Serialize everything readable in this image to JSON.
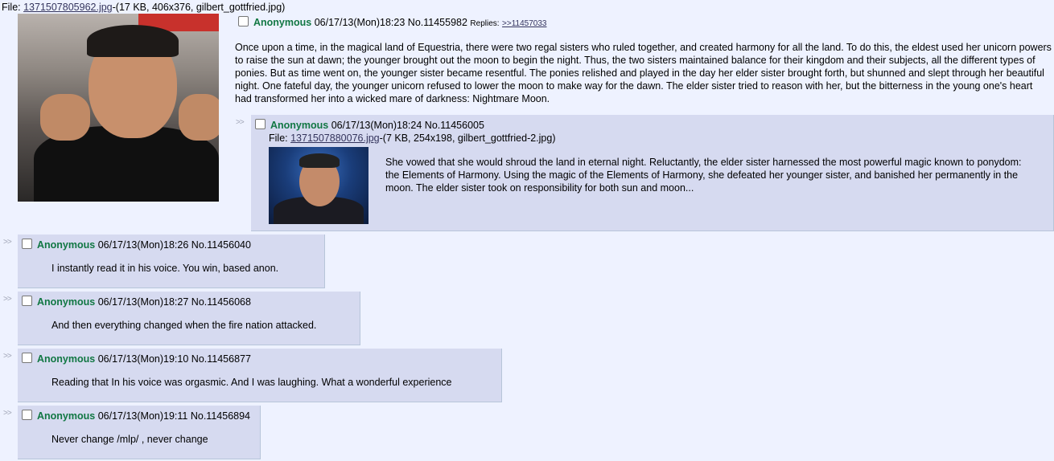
{
  "op": {
    "file_label": "File: ",
    "file_name": "1371507805962.jpg",
    "file_meta": "-(17 KB, 406x376, gilbert_gottfried.jpg)",
    "name": "Anonymous",
    "datetime": "06/17/13(Mon)18:23",
    "post_number": "No.11455982",
    "replies_label": "Replies:",
    "replies_link": ">>11457033",
    "message": "Once upon a time, in the magical land of Equestria, there were two regal sisters who ruled together, and created harmony for all the land. To do this, the eldest used her unicorn powers to raise the sun at dawn; the younger brought out the moon to begin the night. Thus, the two sisters maintained balance for their kingdom and their subjects, all the different types of ponies. But as time went on, the younger sister became resentful. The ponies relished and played in the day her elder sister brought forth, but shunned and slept through her beautiful night. One fateful day, the younger unicorn refused to lower the moon to make way for the dawn. The elder sister tried to reason with her, but the bitterness in the young one's heart had transformed her into a wicked mare of darkness: Nightmare Moon."
  },
  "replies": [
    {
      "side_arrows": ">>",
      "name": "Anonymous",
      "datetime": "06/17/13(Mon)18:24",
      "post_number": "No.11456005",
      "file_label": "File: ",
      "file_name": "1371507880076.jpg",
      "file_meta": "-(7 KB, 254x198, gilbert_gottfried-2.jpg)",
      "message": "She vowed that she would shroud the land in eternal night. Reluctantly, the elder sister harnessed the most powerful magic known to ponydom: the Elements of Harmony. Using the magic of the Elements of Harmony, she defeated her younger sister, and banished her permanently in the moon. The elder sister took on responsibility for both sun and moon..."
    },
    {
      "side_arrows": ">>",
      "name": "Anonymous",
      "datetime": "06/17/13(Mon)18:26",
      "post_number": "No.11456040",
      "message": "I instantly read it in his voice. You win, based anon."
    },
    {
      "side_arrows": ">>",
      "name": "Anonymous",
      "datetime": "06/17/13(Mon)18:27",
      "post_number": "No.11456068",
      "message": "And then everything changed when the fire nation attacked."
    },
    {
      "side_arrows": ">>",
      "name": "Anonymous",
      "datetime": "06/17/13(Mon)19:10",
      "post_number": "No.11456877",
      "message": "Reading that In his voice was orgasmic. And I was laughing. What a wonderful experience"
    },
    {
      "side_arrows": ">>",
      "name": "Anonymous",
      "datetime": "06/17/13(Mon)19:11",
      "post_number": "No.11456894",
      "message": "Never change /mlp/ , never change"
    }
  ]
}
